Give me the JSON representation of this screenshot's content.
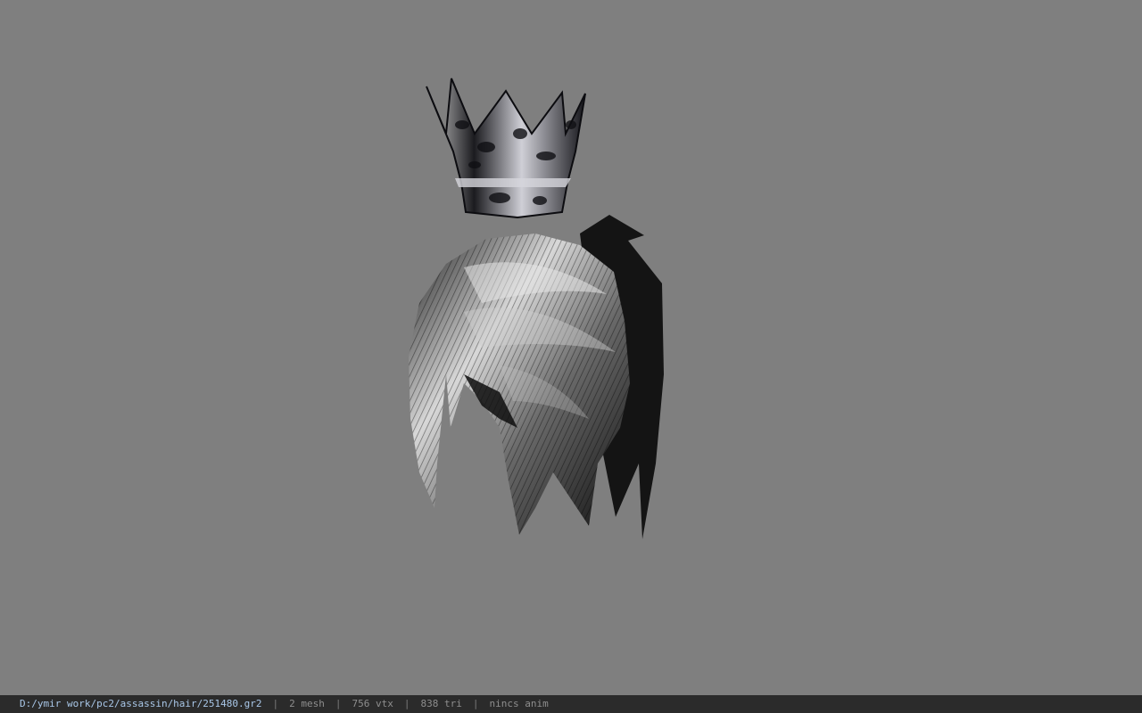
{
  "viewport": {
    "background": "#7f7f7f",
    "model_label": "hair-with-crown-model"
  },
  "status_bar": {
    "path": "D:/ymir work/pc2/assassin/hair/251480.gr2",
    "separator": "|",
    "mesh": "2 mesh",
    "vtx": "756 vtx",
    "tri": "838 tri",
    "anim": "nincs anim",
    "path_color": "#a9c7e8",
    "text_color": "#8e8e8e",
    "background": "#2b2b2b"
  }
}
